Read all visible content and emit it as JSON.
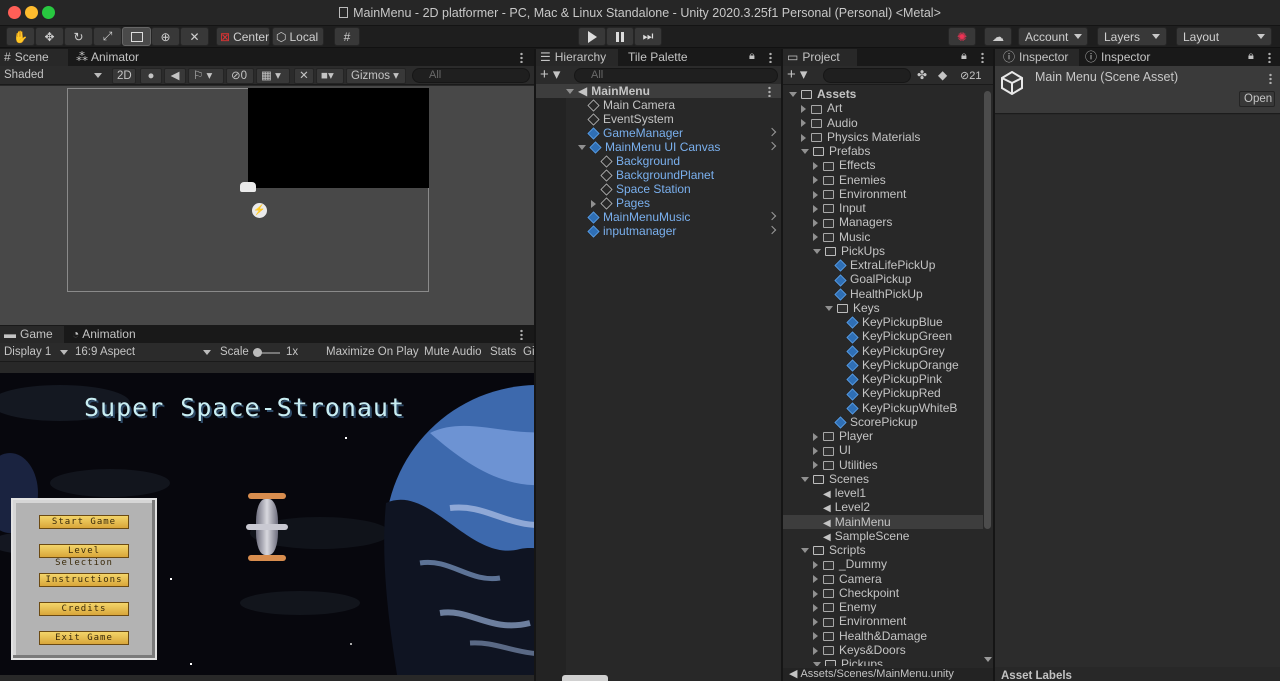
{
  "window": {
    "title": "MainMenu - 2D platformer - PC, Mac & Linux Standalone - Unity 2020.3.25f1 Personal (Personal) <Metal>"
  },
  "toolbar": {
    "pivot_mode": "Center",
    "pivot_rotation": "Local",
    "account_label": "Account",
    "layers_label": "Layers",
    "layout_label": "Layout",
    "tools": [
      "hand-tool-icon",
      "move-tool-icon",
      "rotate-tool-icon",
      "scale-tool-icon",
      "rect-tool-icon",
      "transform-tool-icon",
      "custom-tool-icon"
    ],
    "active_tool": "rect-tool-icon"
  },
  "scene_panel": {
    "tabs": [
      "Scene",
      "Animator"
    ],
    "shading_mode": "Shaded",
    "mode_2d": "2D",
    "hidden_count": "0",
    "gizmos_label": "Gizmos",
    "search_placeholder": "All"
  },
  "game_panel": {
    "tabs": [
      "Game",
      "Animation"
    ],
    "display": "Display 1",
    "aspect": "16:9 Aspect",
    "scale_label": "Scale",
    "scale_value": "1x",
    "maximize_label": "Maximize On Play",
    "mute_label": "Mute Audio",
    "stats_label": "Stats",
    "gizmos_cut": "Gi",
    "game_title": "Super Space-Stronaut",
    "menu_buttons": [
      "Start Game",
      "Level Selection",
      "Instructions",
      "Credits",
      "Exit Game"
    ]
  },
  "hierarchy_panel": {
    "tabs": [
      "Hierarchy",
      "Tile Palette"
    ],
    "search_placeholder": "All",
    "items": [
      {
        "label": "MainMenu",
        "depth": 0,
        "icon": "unity-scene-icon",
        "blue": false,
        "expanded": true,
        "has_menu": true
      },
      {
        "label": "Main Camera",
        "depth": 1,
        "icon": "gameobject-icon",
        "blue": false
      },
      {
        "label": "EventSystem",
        "depth": 1,
        "icon": "gameobject-icon",
        "blue": false
      },
      {
        "label": "GameManager",
        "depth": 1,
        "icon": "prefab-icon",
        "blue": true,
        "has_chevron": true
      },
      {
        "label": "MainMenu UI Canvas",
        "depth": 1,
        "icon": "prefab-icon",
        "blue": true,
        "expanded": true,
        "has_chevron": true
      },
      {
        "label": "Background",
        "depth": 2,
        "icon": "gameobject-icon",
        "blue": true
      },
      {
        "label": "BackgroundPlanet",
        "depth": 2,
        "icon": "gameobject-icon",
        "blue": true
      },
      {
        "label": "Space Station",
        "depth": 2,
        "icon": "gameobject-icon",
        "blue": true
      },
      {
        "label": "Pages",
        "depth": 2,
        "icon": "gameobject-icon",
        "blue": true,
        "collapsed": true
      },
      {
        "label": "MainMenuMusic",
        "depth": 1,
        "icon": "prefab-icon",
        "blue": true,
        "has_chevron": true
      },
      {
        "label": "inputmanager",
        "depth": 1,
        "icon": "prefab-icon",
        "blue": true,
        "has_chevron": true
      }
    ]
  },
  "project_panel": {
    "tab": "Project",
    "hidden_packages_count": "21",
    "status_path": "Assets/Scenes/MainMenu.unity",
    "tree": [
      {
        "label": "Assets",
        "depth": 0,
        "type": "folder",
        "state": "open",
        "bold": true
      },
      {
        "label": "Art",
        "depth": 1,
        "type": "folder",
        "state": "closed"
      },
      {
        "label": "Audio",
        "depth": 1,
        "type": "folder",
        "state": "closed"
      },
      {
        "label": "Physics Materials",
        "depth": 1,
        "type": "folder",
        "state": "closed"
      },
      {
        "label": "Prefabs",
        "depth": 1,
        "type": "folder",
        "state": "open"
      },
      {
        "label": "Effects",
        "depth": 2,
        "type": "folder",
        "state": "closed"
      },
      {
        "label": "Enemies",
        "depth": 2,
        "type": "folder",
        "state": "closed"
      },
      {
        "label": "Environment",
        "depth": 2,
        "type": "folder",
        "state": "closed"
      },
      {
        "label": "Input",
        "depth": 2,
        "type": "folder",
        "state": "closed"
      },
      {
        "label": "Managers",
        "depth": 2,
        "type": "folder",
        "state": "closed"
      },
      {
        "label": "Music",
        "depth": 2,
        "type": "folder",
        "state": "closed"
      },
      {
        "label": "PickUps",
        "depth": 2,
        "type": "folder",
        "state": "open"
      },
      {
        "label": "ExtraLifePickUp",
        "depth": 3,
        "type": "prefab"
      },
      {
        "label": "GoalPickup",
        "depth": 3,
        "type": "prefab"
      },
      {
        "label": "HealthPickUp",
        "depth": 3,
        "type": "prefab"
      },
      {
        "label": "Keys",
        "depth": 3,
        "type": "folder",
        "state": "open"
      },
      {
        "label": "KeyPickupBlue",
        "depth": 4,
        "type": "prefab"
      },
      {
        "label": "KeyPickupGreen",
        "depth": 4,
        "type": "prefab"
      },
      {
        "label": "KeyPickupGrey",
        "depth": 4,
        "type": "prefab"
      },
      {
        "label": "KeyPickupOrange",
        "depth": 4,
        "type": "prefab"
      },
      {
        "label": "KeyPickupPink",
        "depth": 4,
        "type": "prefab"
      },
      {
        "label": "KeyPickupRed",
        "depth": 4,
        "type": "prefab"
      },
      {
        "label": "KeyPickupWhiteB",
        "depth": 4,
        "type": "prefab"
      },
      {
        "label": "ScorePickup",
        "depth": 3,
        "type": "prefab"
      },
      {
        "label": "Player",
        "depth": 2,
        "type": "folder",
        "state": "closed"
      },
      {
        "label": "UI",
        "depth": 2,
        "type": "folder",
        "state": "closed"
      },
      {
        "label": "Utilities",
        "depth": 2,
        "type": "folder",
        "state": "closed"
      },
      {
        "label": "Scenes",
        "depth": 1,
        "type": "folder",
        "state": "open"
      },
      {
        "label": "level1",
        "depth": 2,
        "type": "scene"
      },
      {
        "label": "Level2",
        "depth": 2,
        "type": "scene"
      },
      {
        "label": "MainMenu",
        "depth": 2,
        "type": "scene",
        "selected": true
      },
      {
        "label": "SampleScene",
        "depth": 2,
        "type": "scene"
      },
      {
        "label": "Scripts",
        "depth": 1,
        "type": "folder",
        "state": "open"
      },
      {
        "label": "_Dummy",
        "depth": 2,
        "type": "folder",
        "state": "closed"
      },
      {
        "label": "Camera",
        "depth": 2,
        "type": "folder",
        "state": "closed"
      },
      {
        "label": "Checkpoint",
        "depth": 2,
        "type": "folder",
        "state": "closed"
      },
      {
        "label": "Enemy",
        "depth": 2,
        "type": "folder",
        "state": "closed"
      },
      {
        "label": "Environment",
        "depth": 2,
        "type": "folder",
        "state": "closed"
      },
      {
        "label": "Health&Damage",
        "depth": 2,
        "type": "folder",
        "state": "closed"
      },
      {
        "label": "Keys&Doors",
        "depth": 2,
        "type": "folder",
        "state": "closed"
      },
      {
        "label": "Pickups",
        "depth": 2,
        "type": "folder",
        "state": "open"
      }
    ]
  },
  "inspector_panel": {
    "tabs": [
      "Inspector",
      "Inspector"
    ],
    "asset_title": "Main Menu (Scene Asset)",
    "open_button": "Open",
    "asset_labels": "Asset Labels"
  }
}
